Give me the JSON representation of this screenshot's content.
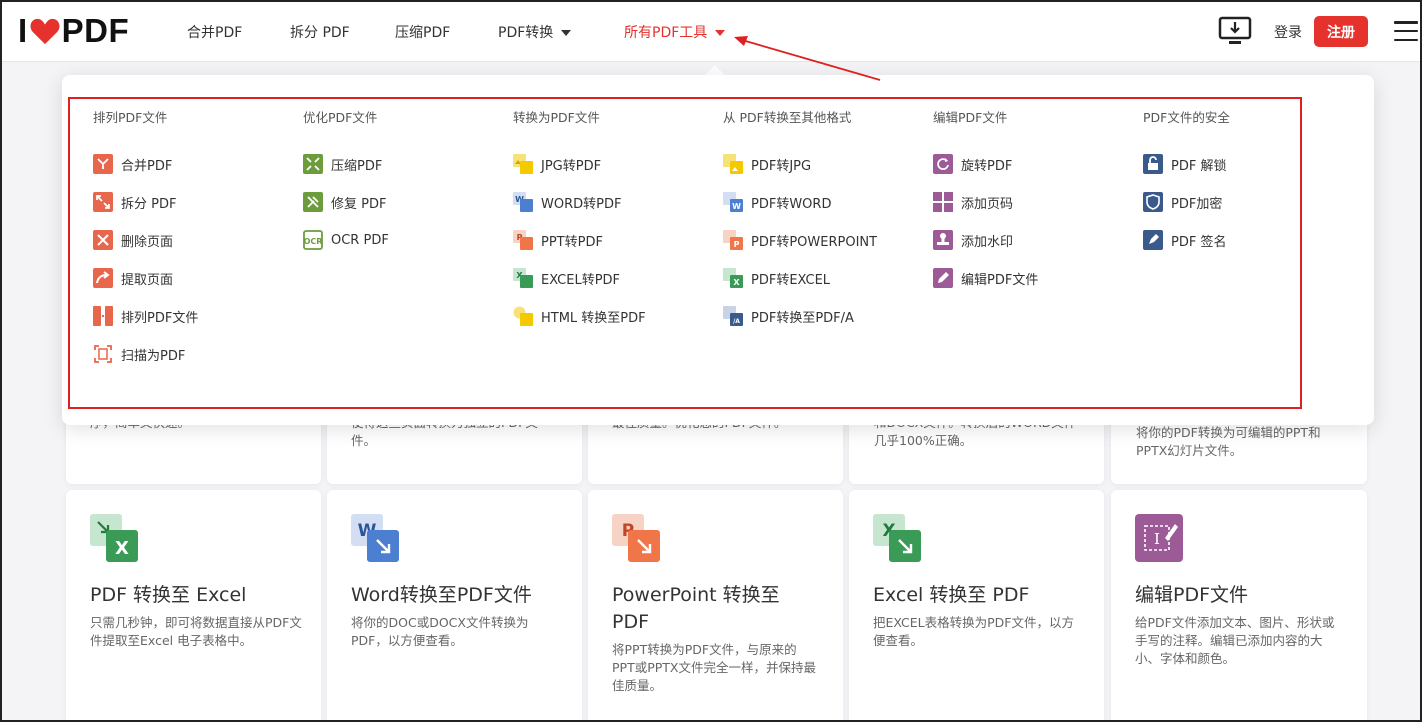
{
  "header": {
    "logo_text_left": "I",
    "logo_text_right": "PDF",
    "nav": [
      {
        "label": "合并PDF"
      },
      {
        "label": "拆分 PDF"
      },
      {
        "label": "压缩PDF"
      },
      {
        "label": "PDF转换"
      },
      {
        "label": "所有PDF工具"
      }
    ],
    "login": "登录",
    "register": "注册"
  },
  "menu": {
    "columns": [
      {
        "heading": "排列PDF文件",
        "tools": [
          "合并PDF",
          "拆分 PDF",
          "删除页面",
          "提取页面",
          "排列PDF文件",
          "扫描为PDF"
        ]
      },
      {
        "heading": "优化PDF文件",
        "tools": [
          "压缩PDF",
          "修复 PDF",
          "OCR PDF"
        ]
      },
      {
        "heading": "转换为PDF文件",
        "tools": [
          "JPG转PDF",
          "WORD转PDF",
          "PPT转PDF",
          "EXCEL转PDF",
          "HTML 转换至PDF"
        ]
      },
      {
        "heading": "从 PDF转换至其他格式",
        "tools": [
          "PDF转JPG",
          "PDF转WORD",
          "PDF转POWERPOINT",
          "PDF转EXCEL",
          "PDF转换至PDF/A"
        ]
      },
      {
        "heading": "编辑PDF文件",
        "tools": [
          "旋转PDF",
          "添加页码",
          "添加水印",
          "编辑PDF文件"
        ]
      },
      {
        "heading": "PDF文件的安全",
        "tools": [
          "PDF 解锁",
          "PDF加密",
          "PDF 签名"
        ]
      }
    ]
  },
  "behind_cards": {
    "c1": "序，简单又快速。",
    "c2": "使得这些页面转换为独立的PDF文件。",
    "c3": "最佳质量。优化您的PDF文件。",
    "c4": "和DOCX文件。转换后的WORD文件几乎100%正确。",
    "c5": "将你的PDF转换为可编辑的PPT和PPTX幻灯片文件。"
  },
  "cards": [
    {
      "title": "PDF 转换至 Excel",
      "desc": "只需几秒钟，即可将数据直接从PDF文件提取至Excel 电子表格中。",
      "icon": "pdf-to-excel-icon"
    },
    {
      "title": "Word转换至PDF文件",
      "desc": "将你的DOC或DOCX文件转换为PDF，以方便查看。",
      "icon": "word-to-pdf-icon"
    },
    {
      "title": "PowerPoint 转换至PDF",
      "desc": "将PPT转换为PDF文件，与原来的PPT或PPTX文件完全一样，并保持最佳质量。",
      "icon": "ppt-to-pdf-icon"
    },
    {
      "title": "Excel 转换至 PDF",
      "desc": "把EXCEL表格转换为PDF文件，以方便查看。",
      "icon": "excel-to-pdf-icon"
    },
    {
      "title": "编辑PDF文件",
      "desc": "给PDF文件添加文本、图片、形状或手写的注释。编辑已添加内容的大小、字体和颜色。",
      "icon": "edit-pdf-icon"
    }
  ],
  "colors": {
    "brand": "#e5322d",
    "annotation": "#e02020"
  }
}
